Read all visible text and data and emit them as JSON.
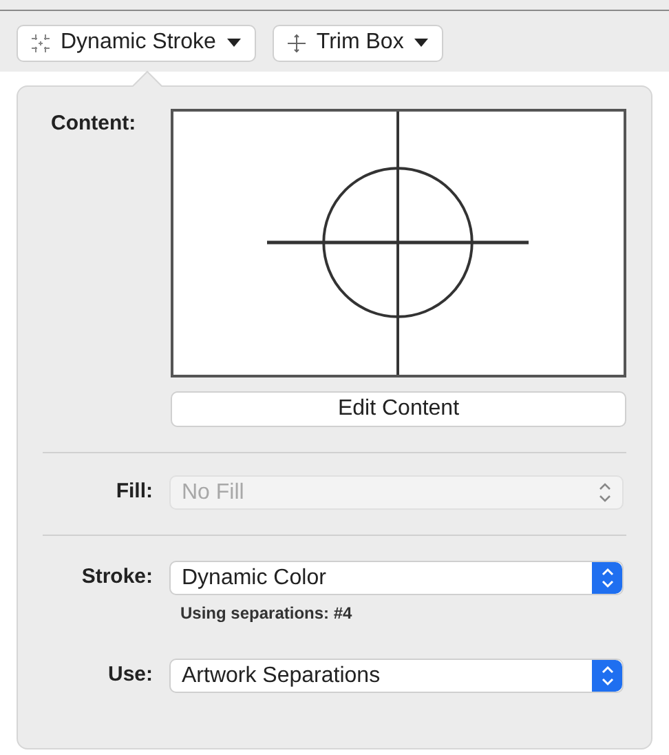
{
  "toolbar": [
    {
      "label": "Dynamic Stroke"
    },
    {
      "label": "Trim Box"
    }
  ],
  "content": {
    "label": "Content:",
    "button": "Edit Content"
  },
  "fields": [
    {
      "label": "Fill:",
      "value": "No Fill",
      "disabled": true
    },
    {
      "label": "Stroke:",
      "value": "Dynamic Color",
      "disabled": false,
      "note": "Using separations: #4"
    },
    {
      "label": "Use:",
      "value": "Artwork Separations",
      "disabled": false
    }
  ]
}
